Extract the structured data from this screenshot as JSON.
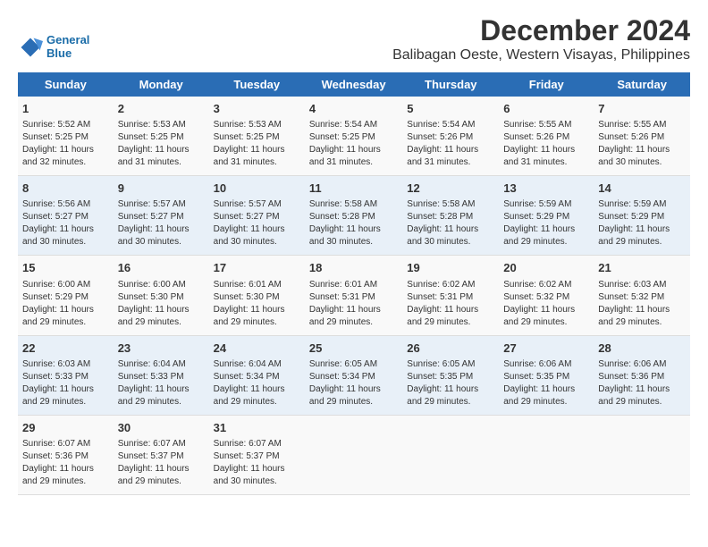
{
  "logo": {
    "line1": "General",
    "line2": "Blue"
  },
  "title": "December 2024",
  "subtitle": "Balibagan Oeste, Western Visayas, Philippines",
  "days_of_week": [
    "Sunday",
    "Monday",
    "Tuesday",
    "Wednesday",
    "Thursday",
    "Friday",
    "Saturday"
  ],
  "weeks": [
    [
      {
        "day": "1",
        "sunrise": "5:52 AM",
        "sunset": "5:25 PM",
        "daylight": "11 hours and 32 minutes."
      },
      {
        "day": "2",
        "sunrise": "5:53 AM",
        "sunset": "5:25 PM",
        "daylight": "11 hours and 31 minutes."
      },
      {
        "day": "3",
        "sunrise": "5:53 AM",
        "sunset": "5:25 PM",
        "daylight": "11 hours and 31 minutes."
      },
      {
        "day": "4",
        "sunrise": "5:54 AM",
        "sunset": "5:25 PM",
        "daylight": "11 hours and 31 minutes."
      },
      {
        "day": "5",
        "sunrise": "5:54 AM",
        "sunset": "5:26 PM",
        "daylight": "11 hours and 31 minutes."
      },
      {
        "day": "6",
        "sunrise": "5:55 AM",
        "sunset": "5:26 PM",
        "daylight": "11 hours and 31 minutes."
      },
      {
        "day": "7",
        "sunrise": "5:55 AM",
        "sunset": "5:26 PM",
        "daylight": "11 hours and 30 minutes."
      }
    ],
    [
      {
        "day": "8",
        "sunrise": "5:56 AM",
        "sunset": "5:27 PM",
        "daylight": "11 hours and 30 minutes."
      },
      {
        "day": "9",
        "sunrise": "5:57 AM",
        "sunset": "5:27 PM",
        "daylight": "11 hours and 30 minutes."
      },
      {
        "day": "10",
        "sunrise": "5:57 AM",
        "sunset": "5:27 PM",
        "daylight": "11 hours and 30 minutes."
      },
      {
        "day": "11",
        "sunrise": "5:58 AM",
        "sunset": "5:28 PM",
        "daylight": "11 hours and 30 minutes."
      },
      {
        "day": "12",
        "sunrise": "5:58 AM",
        "sunset": "5:28 PM",
        "daylight": "11 hours and 30 minutes."
      },
      {
        "day": "13",
        "sunrise": "5:59 AM",
        "sunset": "5:29 PM",
        "daylight": "11 hours and 29 minutes."
      },
      {
        "day": "14",
        "sunrise": "5:59 AM",
        "sunset": "5:29 PM",
        "daylight": "11 hours and 29 minutes."
      }
    ],
    [
      {
        "day": "15",
        "sunrise": "6:00 AM",
        "sunset": "5:29 PM",
        "daylight": "11 hours and 29 minutes."
      },
      {
        "day": "16",
        "sunrise": "6:00 AM",
        "sunset": "5:30 PM",
        "daylight": "11 hours and 29 minutes."
      },
      {
        "day": "17",
        "sunrise": "6:01 AM",
        "sunset": "5:30 PM",
        "daylight": "11 hours and 29 minutes."
      },
      {
        "day": "18",
        "sunrise": "6:01 AM",
        "sunset": "5:31 PM",
        "daylight": "11 hours and 29 minutes."
      },
      {
        "day": "19",
        "sunrise": "6:02 AM",
        "sunset": "5:31 PM",
        "daylight": "11 hours and 29 minutes."
      },
      {
        "day": "20",
        "sunrise": "6:02 AM",
        "sunset": "5:32 PM",
        "daylight": "11 hours and 29 minutes."
      },
      {
        "day": "21",
        "sunrise": "6:03 AM",
        "sunset": "5:32 PM",
        "daylight": "11 hours and 29 minutes."
      }
    ],
    [
      {
        "day": "22",
        "sunrise": "6:03 AM",
        "sunset": "5:33 PM",
        "daylight": "11 hours and 29 minutes."
      },
      {
        "day": "23",
        "sunrise": "6:04 AM",
        "sunset": "5:33 PM",
        "daylight": "11 hours and 29 minutes."
      },
      {
        "day": "24",
        "sunrise": "6:04 AM",
        "sunset": "5:34 PM",
        "daylight": "11 hours and 29 minutes."
      },
      {
        "day": "25",
        "sunrise": "6:05 AM",
        "sunset": "5:34 PM",
        "daylight": "11 hours and 29 minutes."
      },
      {
        "day": "26",
        "sunrise": "6:05 AM",
        "sunset": "5:35 PM",
        "daylight": "11 hours and 29 minutes."
      },
      {
        "day": "27",
        "sunrise": "6:06 AM",
        "sunset": "5:35 PM",
        "daylight": "11 hours and 29 minutes."
      },
      {
        "day": "28",
        "sunrise": "6:06 AM",
        "sunset": "5:36 PM",
        "daylight": "11 hours and 29 minutes."
      }
    ],
    [
      {
        "day": "29",
        "sunrise": "6:07 AM",
        "sunset": "5:36 PM",
        "daylight": "11 hours and 29 minutes."
      },
      {
        "day": "30",
        "sunrise": "6:07 AM",
        "sunset": "5:37 PM",
        "daylight": "11 hours and 29 minutes."
      },
      {
        "day": "31",
        "sunrise": "6:07 AM",
        "sunset": "5:37 PM",
        "daylight": "11 hours and 30 minutes."
      },
      null,
      null,
      null,
      null
    ]
  ]
}
